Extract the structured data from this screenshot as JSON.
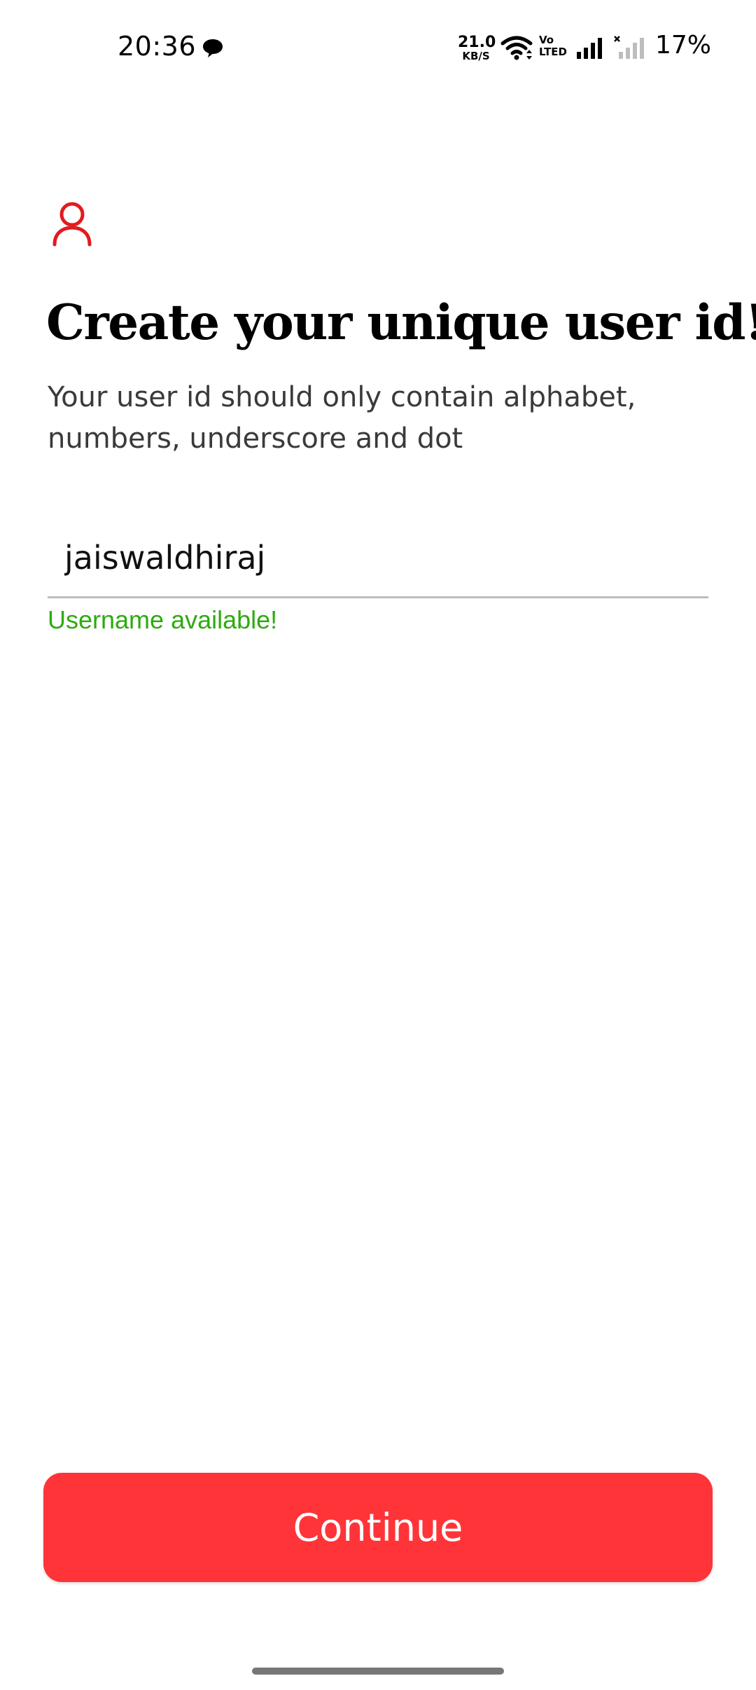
{
  "status_bar": {
    "time": "20:36",
    "net_speed_value": "21.0",
    "net_speed_unit": "KB/S",
    "volte_line1": "Vo",
    "volte_line2": "LTED",
    "battery": "17%",
    "icons": [
      "message-icon",
      "wifi-icon",
      "volte-icon",
      "signal-icon",
      "signal-no-service-icon"
    ]
  },
  "header": {
    "icon": "user-icon",
    "accent_color": "#e21b1f",
    "title": "Create your unique user id!",
    "subtitle": "Your user id should only contain alphabet, numbers, underscore and dot"
  },
  "form": {
    "userid_value": "jaiswaldhiraj",
    "status_text": "Username available!",
    "status_color": "#2eaa0f"
  },
  "actions": {
    "continue_label": "Continue",
    "button_color": "#ff3438"
  }
}
